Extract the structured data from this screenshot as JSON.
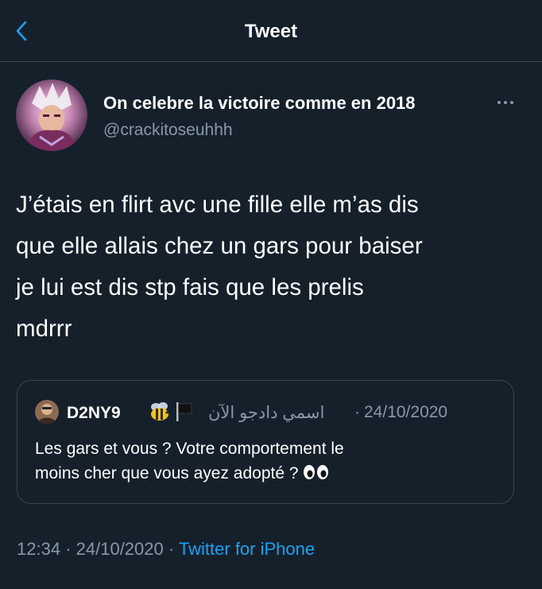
{
  "header": {
    "title": "Tweet",
    "back_icon": "chevron-left-icon",
    "accent_color": "#1da1f2"
  },
  "tweet": {
    "author": {
      "display_name": "On celebre la victoire comme en 2018",
      "handle": "@crackitoseuhhh"
    },
    "more_icon": "ellipsis-icon",
    "text_lines": [
      "J’étais en flirt avc une fille elle m’as dis",
      "que elle allais chez un gars pour baiser",
      "je lui est dis stp fais que les prelis",
      "mdrrr"
    ],
    "time": "12:34",
    "date": "24/10/2020",
    "separator": "·",
    "source": "Twitter for iPhone"
  },
  "quote": {
    "author_name": "D2NY9",
    "emoji_icons": [
      "bee-icon",
      "black-flag-icon"
    ],
    "display_name": "اسمي دادجو الآن",
    "separator": "·",
    "date": "24/10/2020",
    "text_lines": [
      "Les gars et vous ? Votre comportement le",
      "moins cher que vous ayez adopté ?"
    ],
    "trailing_icon": "eyes-icon"
  },
  "colors": {
    "background": "#15202b",
    "border": "#38444d",
    "text_primary": "#ffffff",
    "text_secondary": "#8899a6",
    "link": "#1da1f2"
  }
}
